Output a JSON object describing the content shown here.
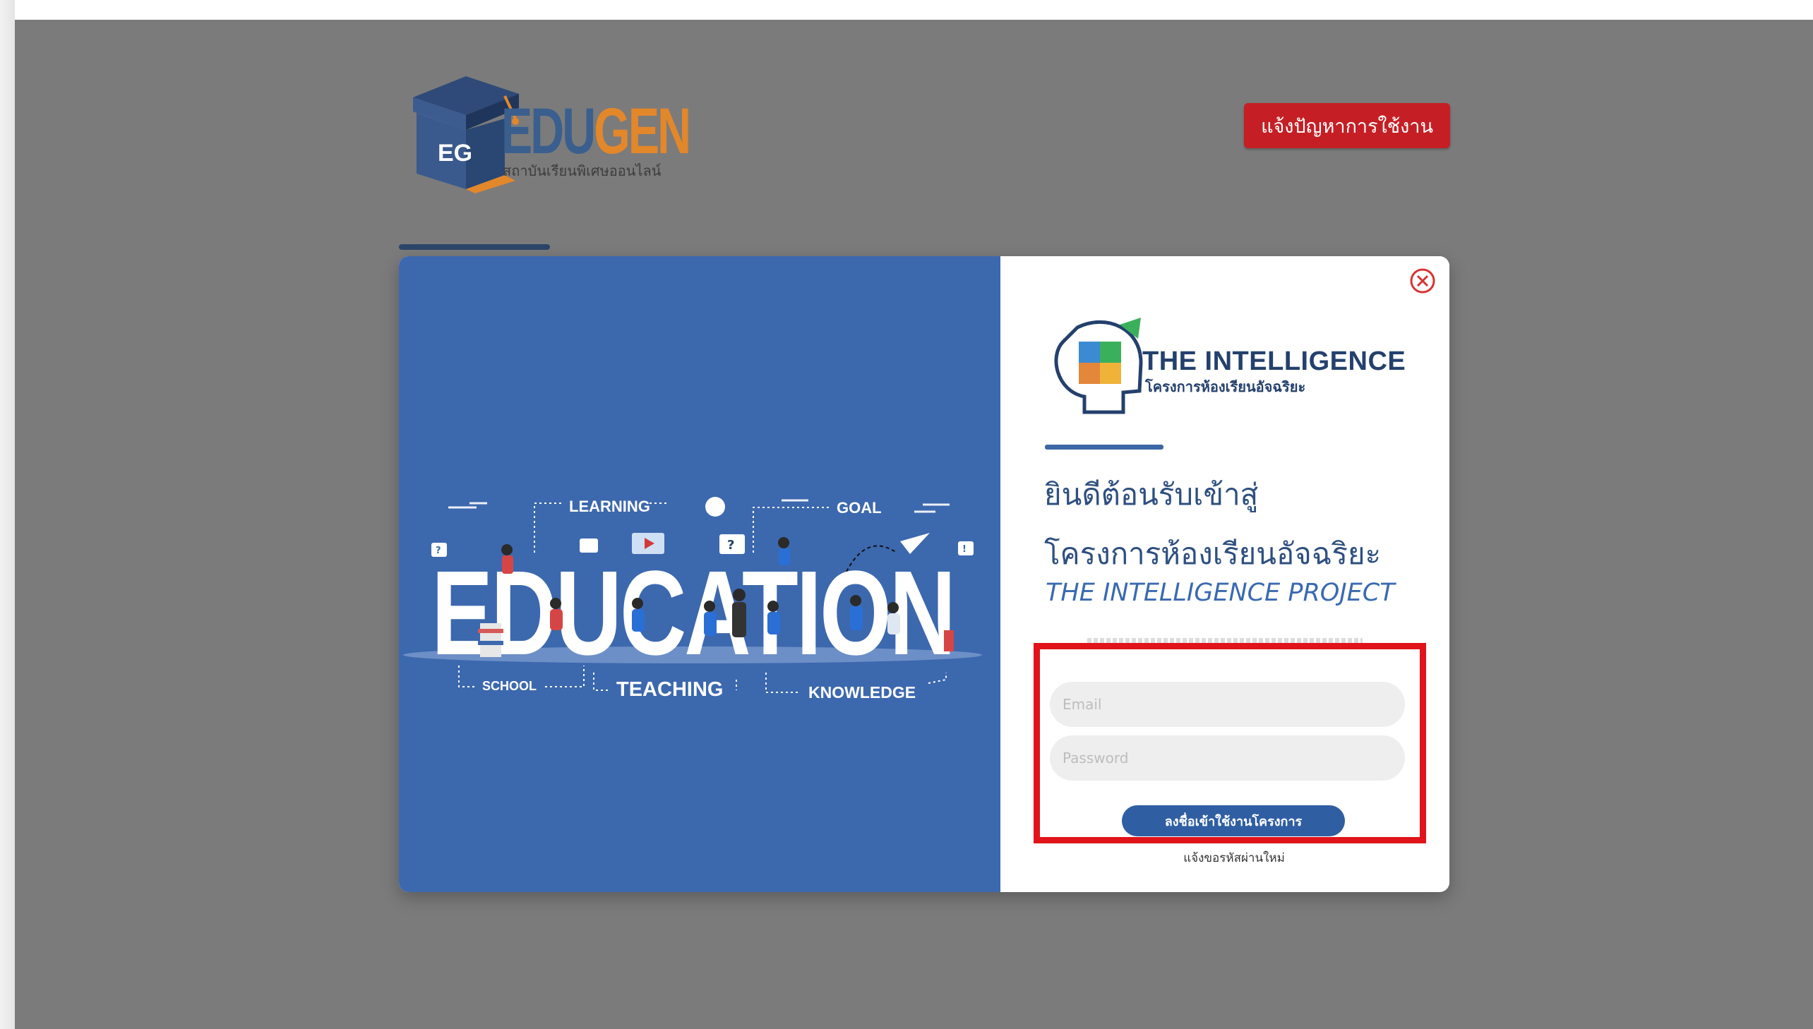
{
  "header": {
    "logo_text_main": "EDU",
    "logo_text_accent": "GEN",
    "logo_letters": "EG",
    "logo_tagline": "สถาบันเรียนพิเศษออนไลน์",
    "report_button_label": "แจ้งปัญหาการใช้งาน"
  },
  "banner": {
    "headline": "EDUCATION",
    "tags": [
      "LEARNING",
      "GOAL",
      "SCHOOL",
      "TEACHING",
      "KNOWLEDGE"
    ]
  },
  "login": {
    "brand_title": "THE INTELLIGENCE",
    "brand_subtitle": "โครงการห้องเรียนอัจฉริยะ",
    "welcome_line1": "ยินดีต้อนรับเข้าสู่",
    "welcome_line2": "โครงการห้องเรียนอัจฉริยะ",
    "welcome_english": "THE INTELLIGENCE PROJECT",
    "email_placeholder": "Email",
    "password_placeholder": "Password",
    "submit_label": "ลงชื่อเข้าใช้งานโครงการ",
    "forgot_label": "แจ้งขอรหัสผ่านใหม่"
  },
  "colors": {
    "backdrop": "#7b7b7b",
    "banner_blue": "#3c68ae",
    "report_red": "#c51f25",
    "highlight_red": "#e0141a",
    "primary_blue": "#2f5ea3"
  },
  "icons": {
    "close": "close-circle-icon",
    "brand": "head-puzzle-icon",
    "logo": "graduation-cap-book-icon"
  }
}
